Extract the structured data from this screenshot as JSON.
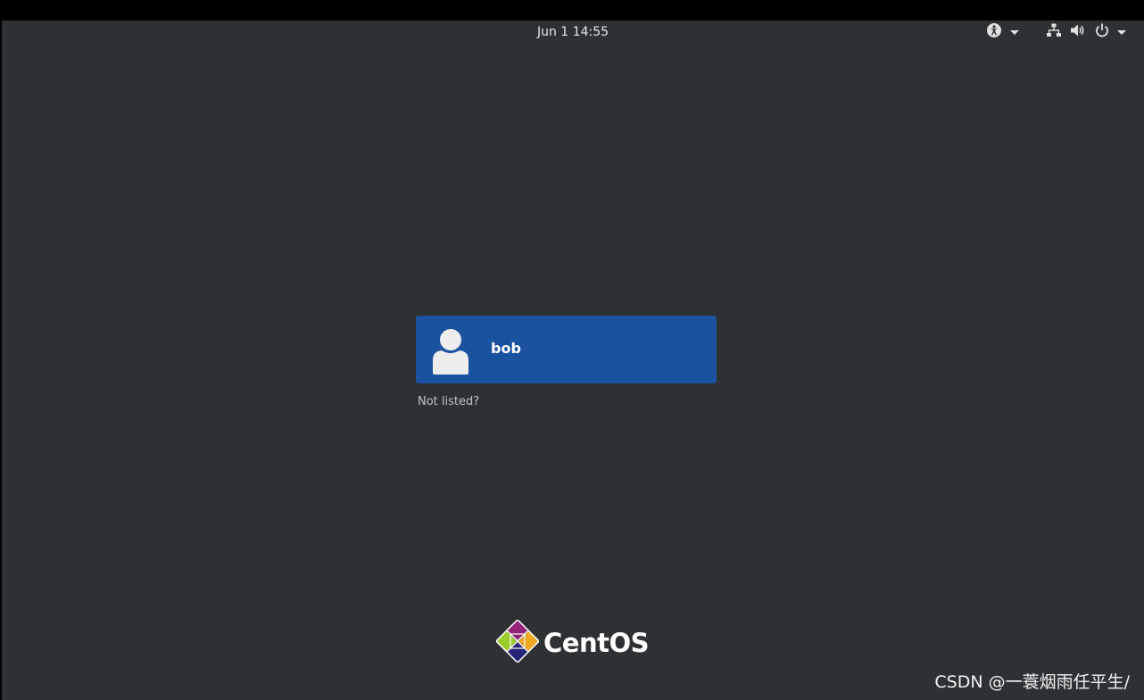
{
  "topbar": {
    "datetime": "Jun 1  14:55",
    "tray_icons": [
      "accessibility-icon",
      "network-wired-icon",
      "volume-icon",
      "power-icon"
    ]
  },
  "login": {
    "users": [
      {
        "name": "bob",
        "avatar_icon": "user-avatar-icon"
      }
    ],
    "not_listed_label": "Not listed?"
  },
  "branding": {
    "logo_text": "CentOS",
    "logo_icon": "centos-logo-icon"
  },
  "watermark": "CSDN @一蓑烟雨任平生/",
  "colors": {
    "background": "#2e3134",
    "topbar": "#000000",
    "selected_user": "#1b52a0"
  }
}
